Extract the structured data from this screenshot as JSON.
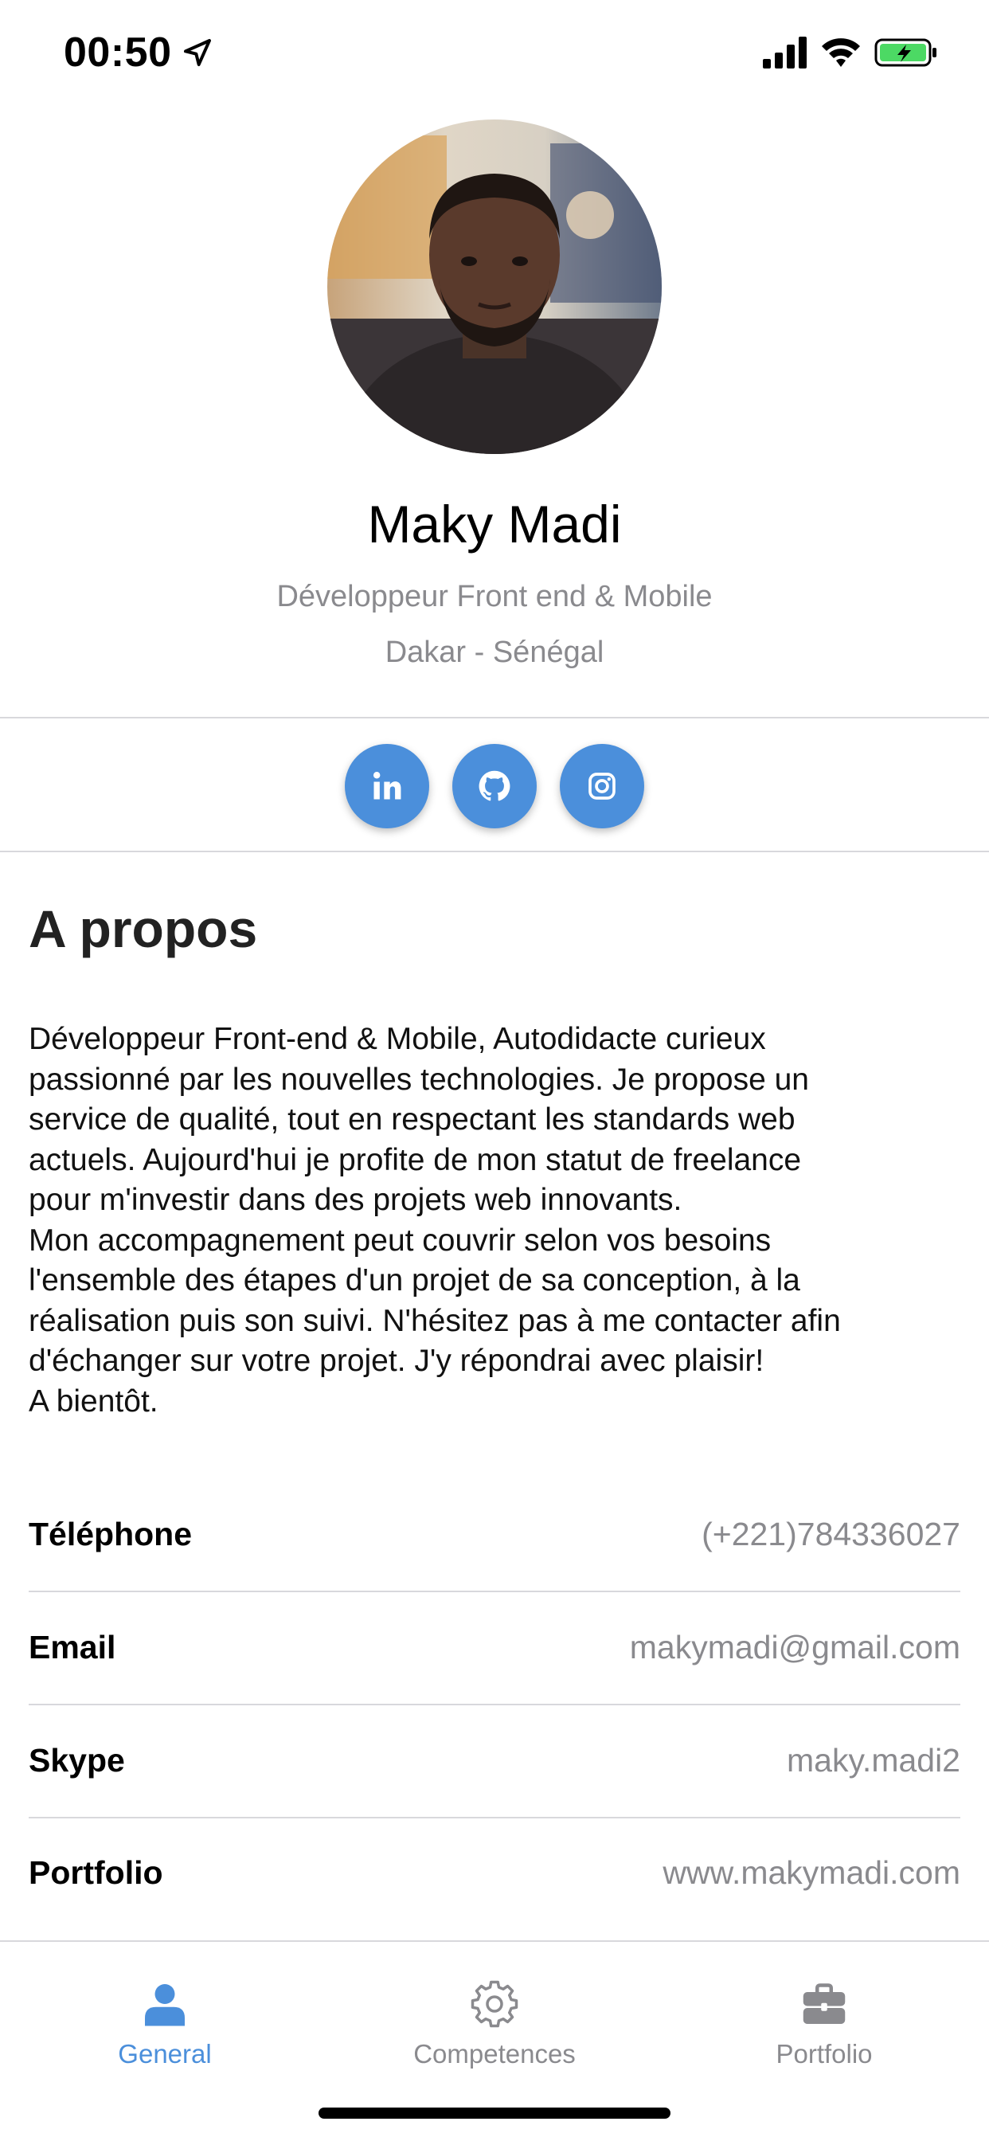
{
  "status": {
    "time": "00:50",
    "icons": [
      "location-arrow-icon",
      "cellular-signal-icon",
      "wifi-icon",
      "battery-charging-icon"
    ]
  },
  "profile": {
    "name": "Maky Madi",
    "role": "Développeur Front end & Mobile",
    "location": "Dakar - Sénégal",
    "avatar_icon": "profile-photo"
  },
  "social": [
    {
      "name": "linkedin",
      "icon": "linkedin-icon"
    },
    {
      "name": "github",
      "icon": "github-icon"
    },
    {
      "name": "instagram",
      "icon": "instagram-icon"
    }
  ],
  "about": {
    "title": "A propos",
    "lines": [
      "Développeur Front-end & Mobile, Autodidacte curieux",
      "passionné par les nouvelles technologies. Je propose un",
      "service de qualité, tout en respectant les standards web",
      "actuels. Aujourd'hui je profite de mon statut de freelance",
      "pour m'investir dans des projets web innovants.",
      "Mon accompagnement peut couvrir selon vos besoins",
      "l'ensemble des étapes d'un projet de sa conception, à la",
      "réalisation puis son suivi. N'hésitez pas à me contacter afin",
      "d'échanger sur votre projet. J'y répondrai avec plaisir!",
      "A bientôt."
    ]
  },
  "contact": [
    {
      "label": "Téléphone",
      "value": "(+221)784336027"
    },
    {
      "label": "Email",
      "value": "makymadi@gmail.com"
    },
    {
      "label": "Skype",
      "value": "maky.madi2"
    },
    {
      "label": "Portfolio",
      "value": "www.makymadi.com"
    }
  ],
  "tabs": [
    {
      "label": "General",
      "icon": "person-icon",
      "active": true
    },
    {
      "label": "Competences",
      "icon": "gear-icon",
      "active": false
    },
    {
      "label": "Portfolio",
      "icon": "briefcase-icon",
      "active": false
    }
  ],
  "colors": {
    "accent": "#4b8fdb",
    "secondary_text": "#8a8a8e",
    "divider": "#d8d8dc"
  }
}
